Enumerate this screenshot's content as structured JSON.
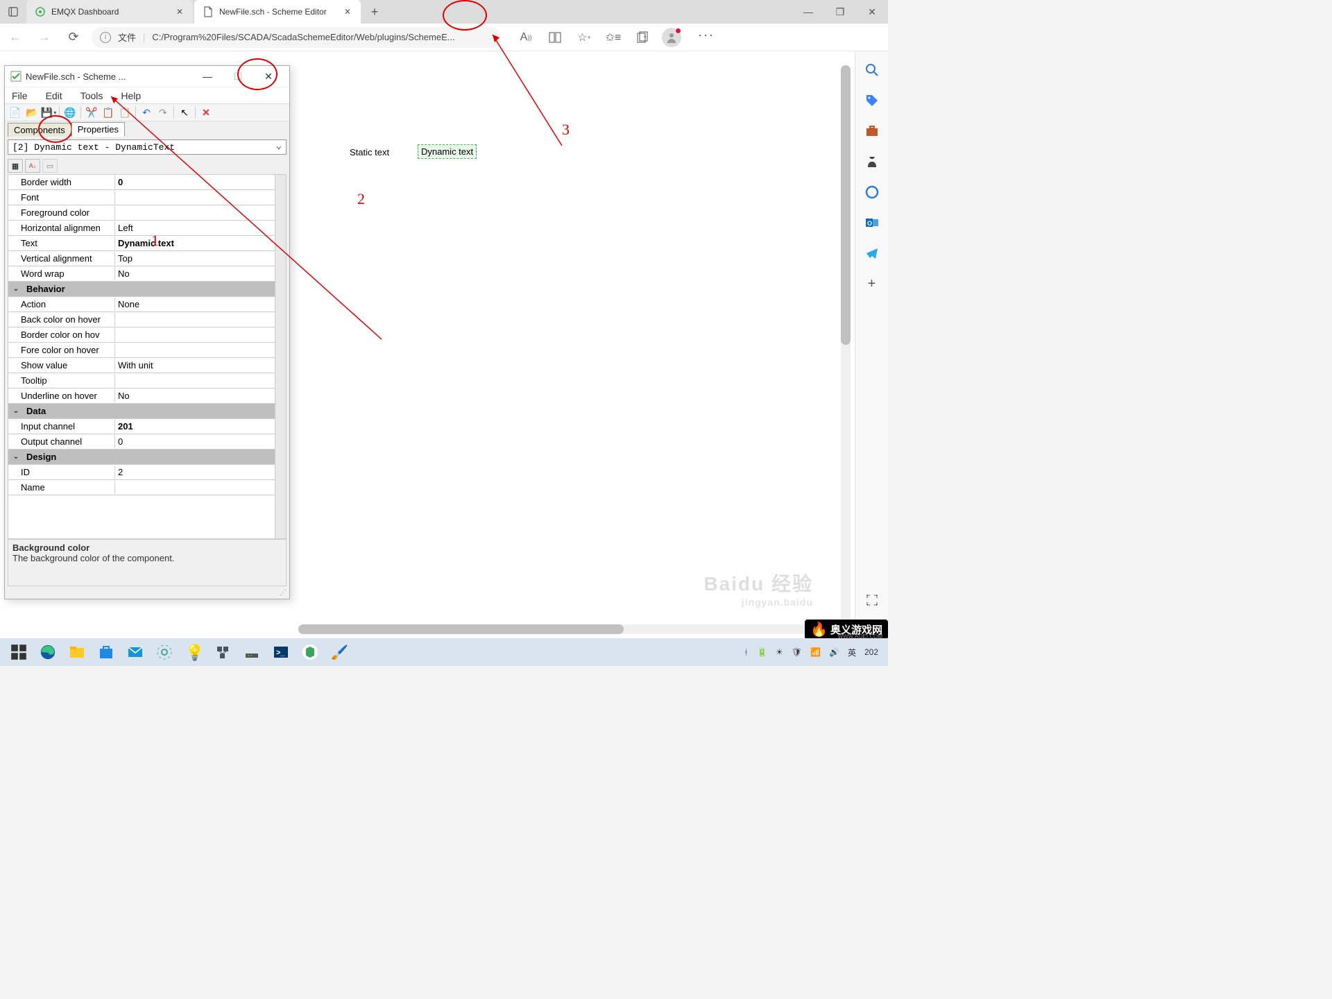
{
  "browser": {
    "tabs": [
      {
        "title": "EMQX Dashboard",
        "active": false
      },
      {
        "title": "NewFile.sch - Scheme Editor",
        "active": true
      }
    ],
    "address_prefix": "文件",
    "address": "C:/Program%20Files/SCADA/ScadaSchemeEditor/Web/plugins/SchemeE...",
    "win_min": "—",
    "win_max": "❐",
    "win_close": "✕"
  },
  "right_sidebar": [
    "search",
    "tag",
    "briefcase",
    "chess",
    "copilot",
    "outlook",
    "telegram",
    "plus",
    "capture",
    "settings"
  ],
  "app": {
    "title": "NewFile.sch - Scheme ...",
    "menu": [
      "File",
      "Edit",
      "Tools",
      "Help"
    ],
    "toolbar_icons": [
      "new",
      "open",
      "save",
      "save-drop",
      "globe",
      "cut",
      "copy",
      "paste",
      "undo",
      "redo",
      "pointer",
      "delete"
    ],
    "tabs": {
      "components": "Components",
      "properties": "Properties"
    },
    "combo": "[2] Dynamic text - DynamicText",
    "mode_icons": [
      "cat",
      "az",
      "page"
    ],
    "rows": [
      {
        "type": "prop",
        "label": "Border width",
        "value": "0",
        "bold": true
      },
      {
        "type": "prop",
        "label": "Font",
        "value": ""
      },
      {
        "type": "prop",
        "label": "Foreground color",
        "value": ""
      },
      {
        "type": "prop",
        "label": "Horizontal alignmen",
        "value": "Left"
      },
      {
        "type": "prop",
        "label": "Text",
        "value": "Dynamic text",
        "bold": true
      },
      {
        "type": "prop",
        "label": "Vertical alignment",
        "value": "Top"
      },
      {
        "type": "prop",
        "label": "Word wrap",
        "value": "No"
      },
      {
        "type": "cat",
        "label": "Behavior"
      },
      {
        "type": "prop",
        "label": "Action",
        "value": "None"
      },
      {
        "type": "prop",
        "label": "Back color on hover",
        "value": ""
      },
      {
        "type": "prop",
        "label": "Border color on hov",
        "value": ""
      },
      {
        "type": "prop",
        "label": "Fore color on hover",
        "value": ""
      },
      {
        "type": "prop",
        "label": "Show value",
        "value": "With unit"
      },
      {
        "type": "prop",
        "label": "Tooltip",
        "value": ""
      },
      {
        "type": "prop",
        "label": "Underline on hover",
        "value": "No"
      },
      {
        "type": "cat",
        "label": "Data"
      },
      {
        "type": "prop",
        "label": "Input channel",
        "value": "201",
        "bold": true
      },
      {
        "type": "prop",
        "label": "Output channel",
        "value": "0"
      },
      {
        "type": "cat",
        "label": "Design"
      },
      {
        "type": "prop",
        "label": "ID",
        "value": "2"
      },
      {
        "type": "prop",
        "label": "Name",
        "value": ""
      }
    ],
    "desc_title": "Background color",
    "desc_body": "The background color of the component."
  },
  "canvas": {
    "static_text": "Static text",
    "dynamic_text": "Dynamic text"
  },
  "annotations": {
    "n1": "1",
    "n2": "2",
    "n3": "3"
  },
  "taskbar": {
    "tray": {
      "ime": "英",
      "year": "202"
    },
    "items": [
      "start",
      "edge",
      "files",
      "store",
      "mail",
      "settings",
      "bulb",
      "net1",
      "net2",
      "terminal",
      "vscode",
      "paint"
    ]
  },
  "watermark": {
    "main": "Baidu 经验",
    "sub": "jingyan.baidu"
  },
  "brand": {
    "text": "奥义游戏网",
    "sub": "WWW.AOEI.COM"
  }
}
